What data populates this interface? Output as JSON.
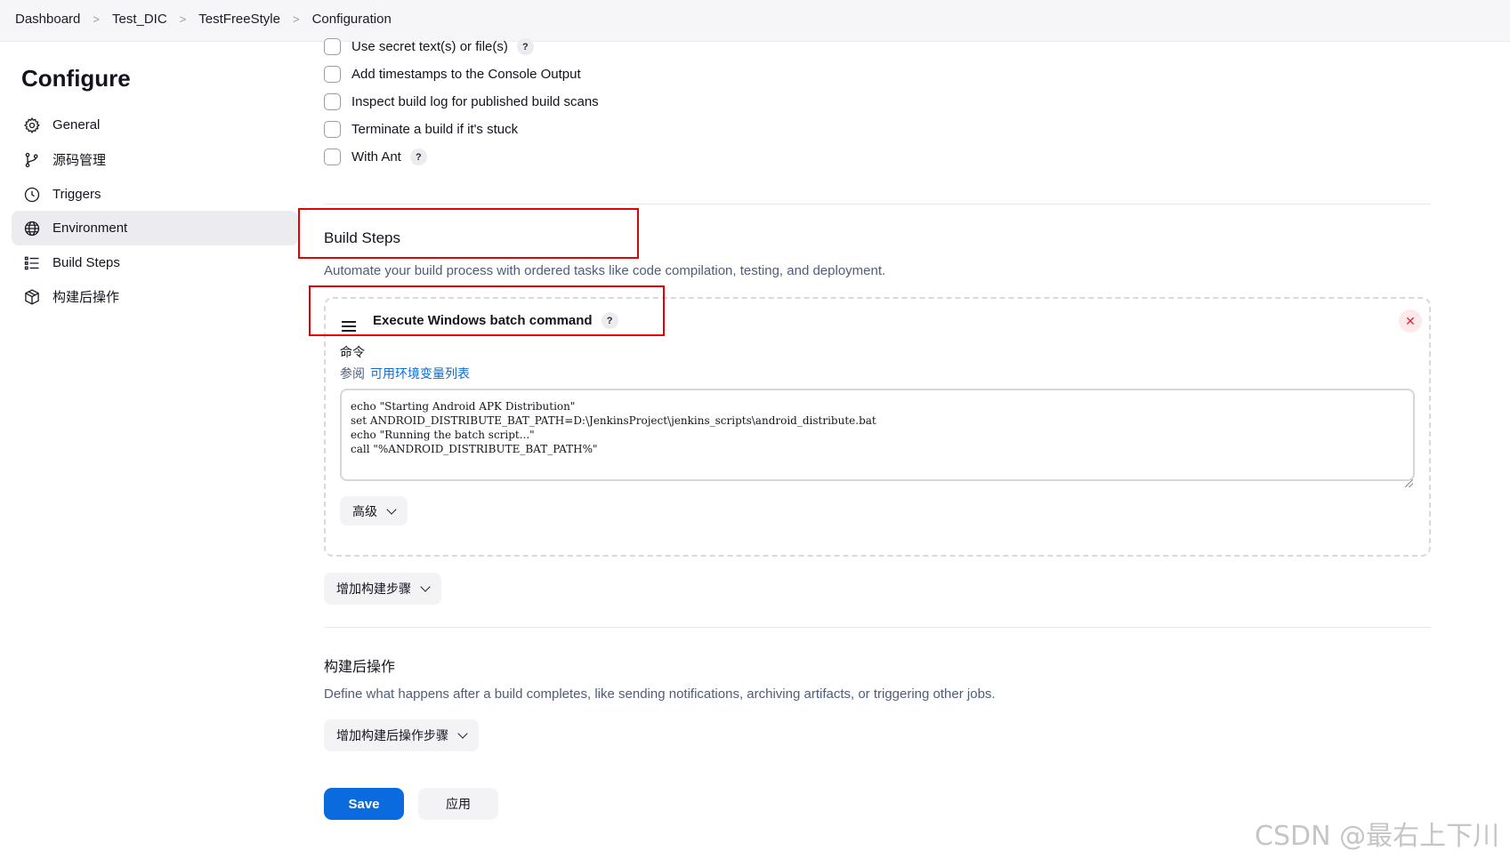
{
  "breadcrumb": [
    "Dashboard",
    "Test_DIC",
    "TestFreeStyle",
    "Configuration"
  ],
  "page_title": "Configure",
  "sidebar": {
    "items": [
      {
        "label": "General",
        "icon": "gear-icon",
        "active": false
      },
      {
        "label": "源码管理",
        "icon": "branch-icon",
        "active": false
      },
      {
        "label": "Triggers",
        "icon": "clock-icon",
        "active": false
      },
      {
        "label": "Environment",
        "icon": "globe-icon",
        "active": true
      },
      {
        "label": "Build Steps",
        "icon": "list-icon",
        "active": false
      },
      {
        "label": "构建后操作",
        "icon": "package-icon",
        "active": false
      }
    ]
  },
  "environment_options": [
    {
      "label": "Use secret text(s) or file(s)",
      "checked": false,
      "help": true
    },
    {
      "label": "Add timestamps to the Console Output",
      "checked": false,
      "help": false
    },
    {
      "label": "Inspect build log for published build scans",
      "checked": false,
      "help": false
    },
    {
      "label": "Terminate a build if it's stuck",
      "checked": false,
      "help": false
    },
    {
      "label": "With Ant",
      "checked": false,
      "help": true
    }
  ],
  "help_glyph": "?",
  "build_steps": {
    "title": "Build Steps",
    "description": "Automate your build process with ordered tasks like code compilation, testing, and deployment.",
    "step": {
      "title": "Execute Windows batch command",
      "close_glyph": "✕",
      "command_label": "命令",
      "see_also_prefix": "参阅",
      "see_also_link": "可用环境变量列表",
      "command": "echo \"Starting Android APK Distribution\"\nset ANDROID_DISTRIBUTE_BAT_PATH=D:\\JenkinsProject\\jenkins_scripts\\android_distribute.bat\necho \"Running the batch script...\"\ncall \"%ANDROID_DISTRIBUTE_BAT_PATH%\"",
      "advanced_label": "高级"
    },
    "add_step_label": "增加构建步骤"
  },
  "post_build": {
    "title": "构建后操作",
    "description": "Define what happens after a build completes, like sending notifications, archiving artifacts, or triggering other jobs.",
    "add_label": "增加构建后操作步骤"
  },
  "buttons": {
    "save": "Save",
    "apply": "应用"
  },
  "watermark": "CSDN @最右上下川",
  "colors": {
    "primary": "#0b6bde",
    "highlight_box": "#e60000",
    "link": "#0b6bd6",
    "active_bg": "#ececf0"
  }
}
